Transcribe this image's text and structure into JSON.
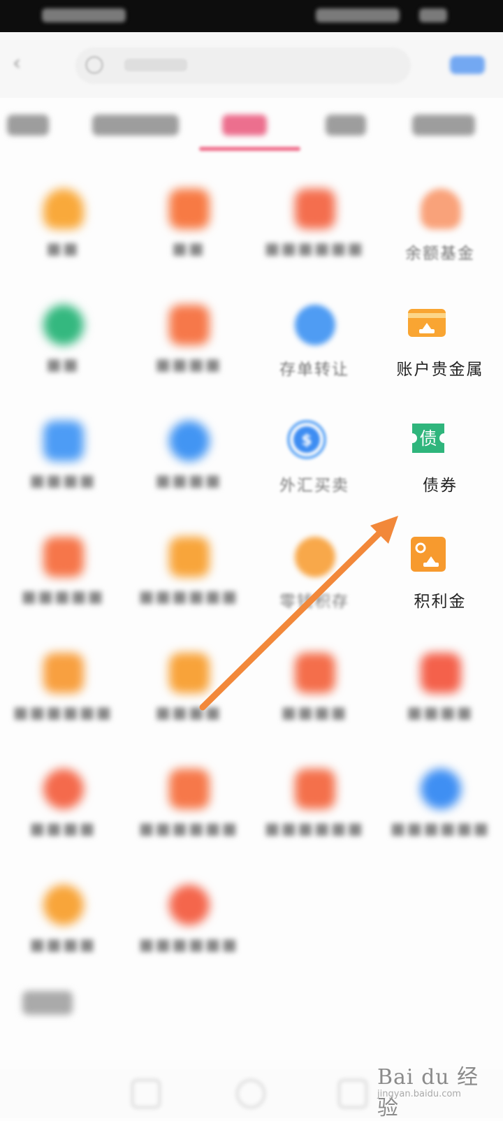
{
  "grid_labels": {
    "yu_e_jijin": "余额基金",
    "cundan_zhuanrang": "存单转让",
    "zhanghu_guijinshu": "账户贵金属",
    "waihui_maimai": "外汇买卖",
    "zhaiquan": "债券",
    "jilijin": "积利金",
    "xiaoyou_jicun": "零钱积存"
  },
  "icons": {
    "zhaiquan_glyph": "债"
  },
  "watermark": {
    "brand": "Bai du 经验",
    "url": "jingyan.baidu.com"
  },
  "colors": {
    "arrow": "#F2883A",
    "tab_active": "#EF6F8C",
    "green_icon": "#2FB57C",
    "orange_icon": "#F7A12E",
    "blue_icon": "#3E8DF2"
  }
}
